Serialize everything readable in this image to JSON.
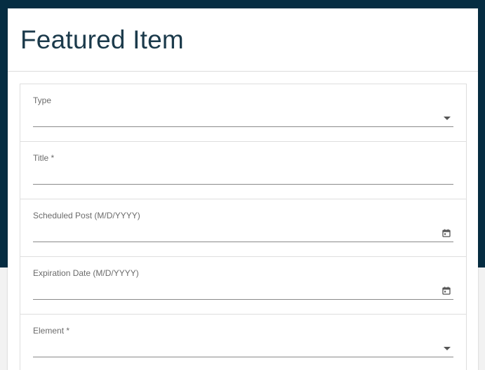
{
  "dialog": {
    "title": "Featured Item"
  },
  "form": {
    "fields": [
      {
        "label": "Type",
        "kind": "select",
        "value": "",
        "icon": "dropdown-arrow-icon"
      },
      {
        "label": "Title *",
        "kind": "text",
        "value": ""
      },
      {
        "label": "Scheduled Post (M/D/YYYY)",
        "kind": "date",
        "value": "",
        "icon": "calendar-icon"
      },
      {
        "label": "Expiration Date (M/D/YYYY)",
        "kind": "date",
        "value": "",
        "icon": "calendar-icon"
      },
      {
        "label": "Element *",
        "kind": "select",
        "value": "",
        "icon": "dropdown-arrow-icon"
      }
    ]
  },
  "colors": {
    "header_band": "#062d42",
    "title_text": "#1b3a4b",
    "page_background": "#f2f2f2"
  }
}
